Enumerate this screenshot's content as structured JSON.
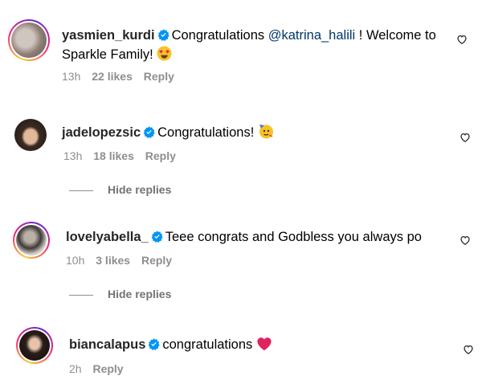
{
  "comments": [
    {
      "username": "yasmien_kurdi",
      "text_before": "Congratulations ",
      "mention": "@katrina_halili",
      "text_after": " ! Welcome to",
      "text_line2": "Sparkle Family!",
      "emoji": "heart-eyes",
      "time": "13h",
      "likes": "22 likes",
      "reply": "Reply"
    },
    {
      "username": "jadelopezsic",
      "text": "Congratulations!",
      "emoji": "partying-face",
      "time": "13h",
      "likes": "18 likes",
      "reply": "Reply",
      "hide_replies": "Hide replies"
    },
    {
      "username": "lovelyabella_",
      "text": "Teee congrats and Godbless you always po",
      "time": "10h",
      "likes": "3 likes",
      "reply": "Reply",
      "hide_replies": "Hide replies"
    },
    {
      "username": "biancalapus",
      "text": "congratulations",
      "emoji": "red-heart",
      "time": "2h",
      "reply": "Reply"
    }
  ],
  "colors": {
    "verified": "#0095f6",
    "meta": "#8e8e8e",
    "mention": "#00376b",
    "heart_emoji": "#e0245e"
  }
}
